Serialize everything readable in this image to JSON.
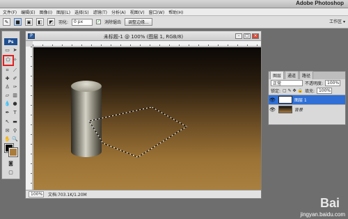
{
  "app": {
    "title": "Adobe Photoshop"
  },
  "menu": [
    "文件(F)",
    "编辑(E)",
    "图像(I)",
    "图层(L)",
    "选择(S)",
    "滤镜(T)",
    "分析(A)",
    "视图(V)",
    "窗口(W)",
    "帮助(H)"
  ],
  "options": {
    "feather_label": "羽化:",
    "feather_value": "0 px",
    "antialias_label": "消除锯齿",
    "refine_edge_label": "调整边缘...",
    "workspace_label": "工作区 ▾"
  },
  "tools": {
    "logo": "Ps"
  },
  "document": {
    "title": "未标题-1 @ 100% (图层 1, RGB/8)",
    "zoom": "100%",
    "doc_info": "文档:703.1K/1.20M"
  },
  "layers_panel": {
    "tabs": [
      "图层",
      "通道",
      "路径"
    ],
    "blend_mode": "正常",
    "opacity_label": "不透明度:",
    "opacity_value": "100%",
    "lock_label": "锁定:",
    "fill_label": "填充:",
    "fill_value": "100%",
    "layers": [
      {
        "name": "图层 1",
        "selected": true
      },
      {
        "name": "背景",
        "selected": false
      }
    ]
  },
  "watermark": {
    "logo": "Bai",
    "url": "jingyan.baidu.com"
  },
  "colors": {
    "foreground": "#0a0a0a",
    "background": "#a97b3c",
    "selection": "#2f6fd6"
  }
}
